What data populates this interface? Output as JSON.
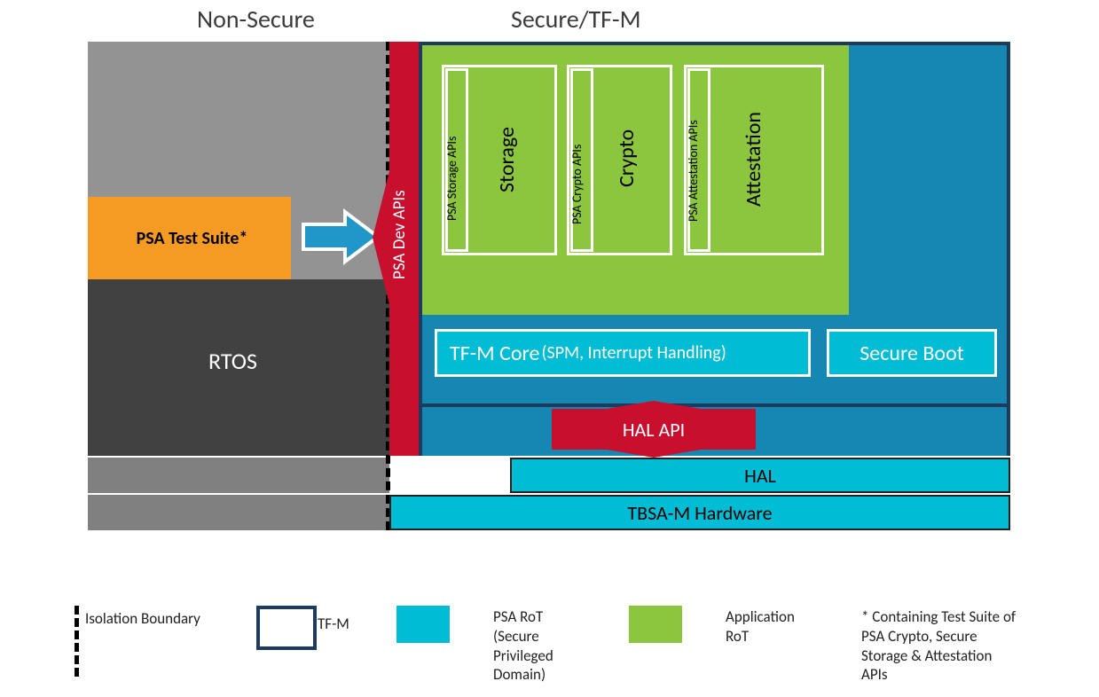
{
  "titles": {
    "nonsecure": "Non-Secure",
    "secure": "Secure/TF-M"
  },
  "nonsecure": {
    "psa_test_suite": "PSA Test Suite*",
    "rtos": "RTOS"
  },
  "psa_dev_apis": "PSA Dev APIs",
  "app_rot": {
    "storage_api": "PSA Storage  APIs",
    "storage": "Storage",
    "crypto_api": "PSA Crypto  APIs",
    "crypto": "Crypto",
    "attest_api": "PSA Attestation  APIs",
    "attest": "Attestation"
  },
  "psa_rot": {
    "tfm_core_prefix": "TF-M Core ",
    "tfm_core_detail": "(SPM, Interrupt Handling)",
    "secure_boot": "Secure Boot"
  },
  "hal_api": "HAL API",
  "hal": "HAL",
  "hardware": "TBSA-M Hardware",
  "legend": {
    "isolation": "Isolation Boundary",
    "tfm": "TF-M",
    "psa_rot1": "PSA RoT",
    "psa_rot2": "(Secure",
    "psa_rot3": "Privileged",
    "psa_rot4": "Domain)",
    "app_rot1": "Application",
    "app_rot2": "RoT",
    "note1": "* Containing Test Suite of",
    "note2": "PSA Crypto, Secure",
    "note3": "Storage & Attestation",
    "note4": "APIs"
  },
  "colors": {
    "gray_light": "#939393",
    "gray_dark": "#414141",
    "gray_mid": "#808080",
    "orange": "#f59a22",
    "red": "#c8102e",
    "cyan": "#00bcd4",
    "blue_medium": "#1687b2",
    "blue_dark": "#0a7aa6",
    "green": "#8cc63f",
    "navy": "#1e3a5f",
    "arrow_blue": "#2196c9"
  }
}
